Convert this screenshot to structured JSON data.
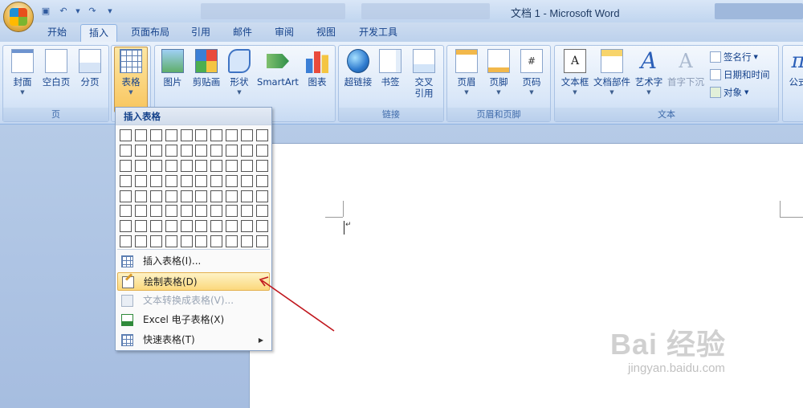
{
  "window": {
    "title": "文档 1 - Microsoft Word"
  },
  "tabs": [
    "开始",
    "插入",
    "页面布局",
    "引用",
    "邮件",
    "审阅",
    "视图",
    "开发工具"
  ],
  "active_tab": "插入",
  "ribbon": {
    "page_group": {
      "label": "页",
      "buttons": [
        "封面",
        "空白页",
        "分页"
      ]
    },
    "table_button": "表格",
    "illus_buttons": [
      "图片",
      "剪贴画",
      "形状",
      "SmartArt",
      "图表"
    ],
    "links_group": {
      "label": "链接",
      "buttons": [
        "超链接",
        "书签",
        "交叉\n引用"
      ],
      "xref_l1": "交叉",
      "xref_l2": "引用"
    },
    "hf_group": {
      "label": "页眉和页脚",
      "buttons": [
        "页眉",
        "页脚",
        "页码"
      ]
    },
    "text_group": {
      "label": "文本",
      "buttons": [
        "文本框",
        "文档部件",
        "艺术字",
        "首字下沉"
      ],
      "small": [
        "签名行",
        "日期和时间",
        "对象"
      ]
    },
    "symbol_partial": "公式"
  },
  "dropdown": {
    "title": "插入表格",
    "grid_cols": 10,
    "grid_rows": 8,
    "items": [
      {
        "label": "插入表格(I)...",
        "icon": "insert-table-icon",
        "state": "normal"
      },
      {
        "label": "绘制表格(D)",
        "icon": "pencil-icon",
        "state": "highlighted"
      },
      {
        "label": "文本转换成表格(V)...",
        "icon": "convert-icon",
        "state": "disabled"
      },
      {
        "label": "Excel 电子表格(X)",
        "icon": "excel-icon",
        "state": "normal"
      },
      {
        "label": "快速表格(T)",
        "icon": "quick-table-icon",
        "state": "normal",
        "submenu": true
      }
    ]
  },
  "watermark": {
    "main": "Bai 经验",
    "sub": "jingyan.baidu.com"
  },
  "colors": {
    "accent": "#15428b",
    "highlight": "#fbd87c",
    "arrow": "#c0161d"
  }
}
